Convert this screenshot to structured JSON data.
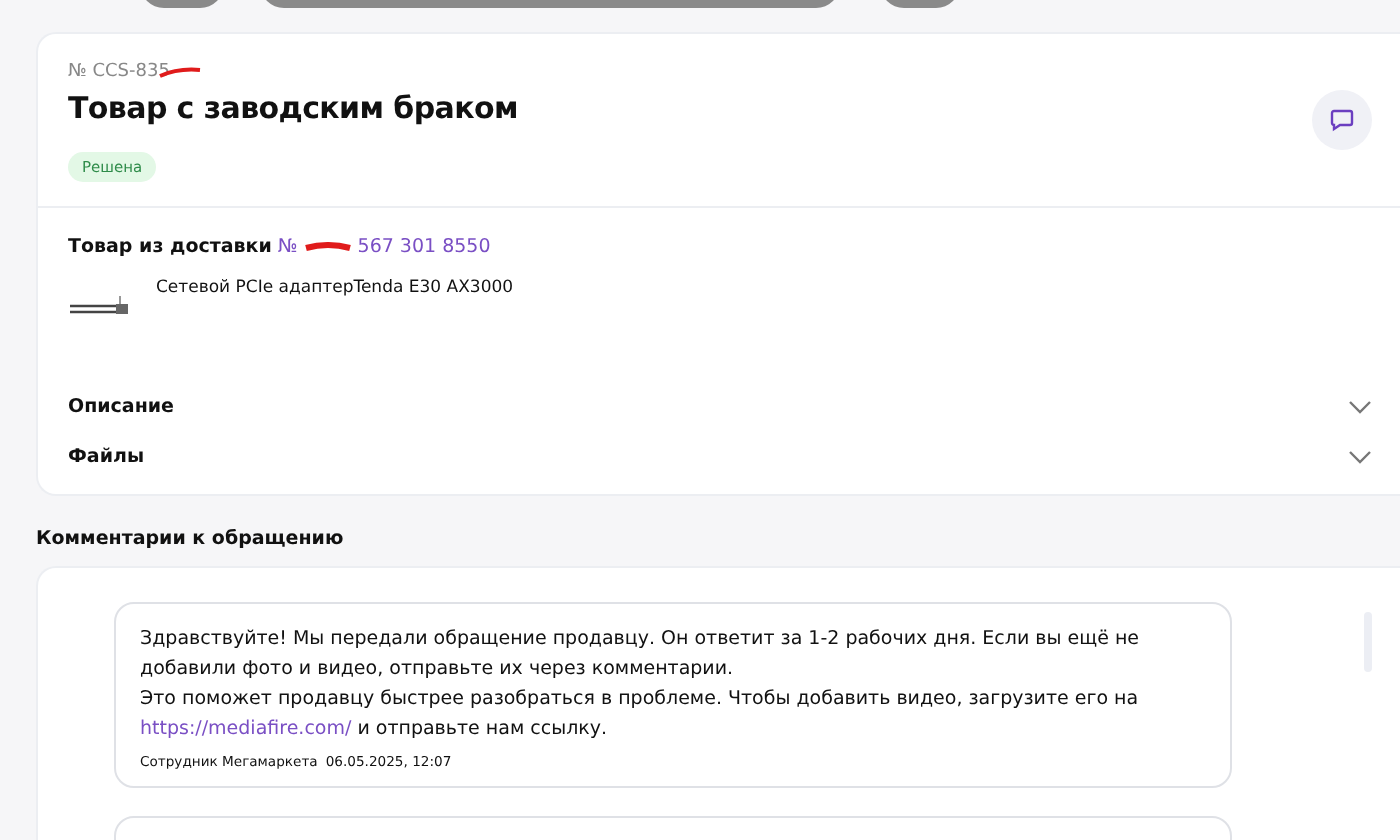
{
  "request": {
    "number": "№ CCS-835",
    "title": "Товар с заводским браком",
    "status": "Решена"
  },
  "delivery": {
    "label": "Товар из доставки",
    "number_prefix": "№",
    "number": "567 301 8550",
    "product": "Сетевой PCIe адаптерTenda E30 AX3000"
  },
  "sections": [
    {
      "label": "Описание",
      "expanded": false
    },
    {
      "label": "Файлы",
      "expanded": false
    }
  ],
  "comments": {
    "title": "Комментарии к обращению",
    "messages": [
      {
        "lines": [
          "Здравствуйте! Мы передали обращение продавцу. Он ответит за 1-2 рабочих дня. Если вы ещё не добавили фото и видео, отправьте их через комментарии.",
          "Это поможет продавцу быстрее разобраться в проблеме. Чтобы добавить видео, загрузите его на"
        ],
        "link": "https://mediafire.com/",
        "after_link": " и отправьте нам ссылку.",
        "author": "Сотрудник Мегамаркета",
        "time": "06.05.2025, 12:07"
      }
    ]
  }
}
